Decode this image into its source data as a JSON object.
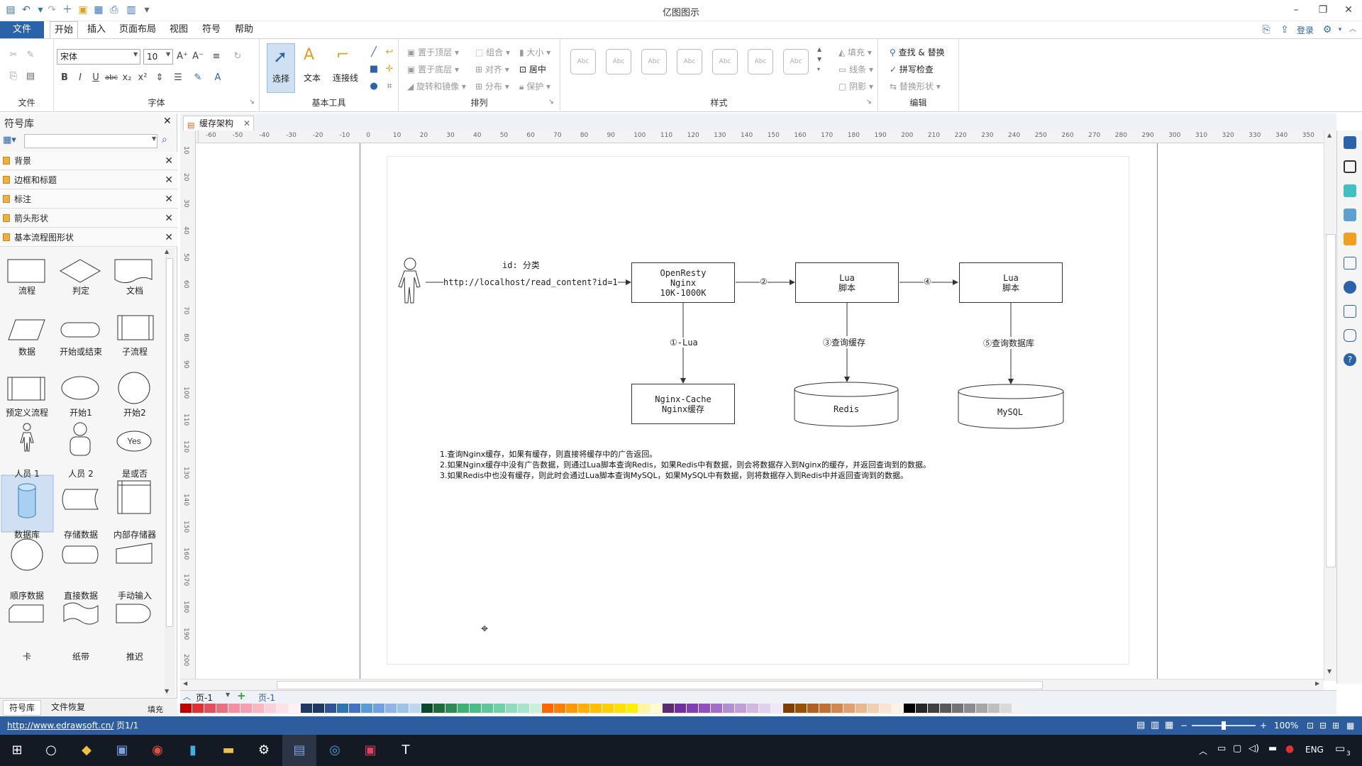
{
  "app": {
    "title": "亿图图示",
    "minimize": "–",
    "restore": "❐",
    "close": "✕"
  },
  "menu": {
    "file": "文件",
    "items": [
      "开始",
      "插入",
      "页面布局",
      "视图",
      "符号",
      "帮助"
    ],
    "login": "登录"
  },
  "ribbon": {
    "groups": {
      "file": "文件",
      "font": "字体",
      "basic_tools": "基本工具",
      "arrange": "排列",
      "style": "样式",
      "edit": "编辑"
    },
    "font_name": "宋体",
    "font_size": "10",
    "tools": {
      "select": "选择",
      "text": "文本",
      "connector": "连接线"
    },
    "arrange": {
      "bring_front": "置于顶层",
      "send_back": "置于底层",
      "rotate": "旋转和镜像",
      "group": "组合",
      "align": "对齐",
      "distribute": "分布",
      "size": "大小",
      "center": "居中",
      "protect": "保护"
    },
    "style_preview": "Abc",
    "fill": {
      "fill": "填充",
      "line": "线条",
      "shadow": "阴影"
    },
    "edit": {
      "find": "查找 & 替换",
      "spell": "拼写检查",
      "replace_shape": "替换形状"
    }
  },
  "library": {
    "title": "符号库",
    "categories": [
      "背景",
      "边框和标题",
      "标注",
      "箭头形状",
      "基本流程图形状"
    ],
    "shapes": [
      "流程",
      "判定",
      "文档",
      "数据",
      "开始或结束",
      "子流程",
      "预定义流程",
      "开始1",
      "开始2",
      "人员 1",
      "人员 2",
      "是或否",
      "数据库",
      "存储数据",
      "内部存储器",
      "顺序数据",
      "直接数据",
      "手动输入",
      "卡",
      "纸带",
      "推迟"
    ],
    "yes_text": "Yes",
    "bottom_tabs": [
      "符号库",
      "文件恢复"
    ]
  },
  "doc_tab": "缓存架构",
  "diagram": {
    "id_label": "id: 分类",
    "url": "http://localhost/read_content?id=1",
    "openresty": [
      "OpenResty",
      "Nginx",
      "10K-1000K"
    ],
    "lua1": [
      "Lua",
      "脚本"
    ],
    "lua2": [
      "Lua",
      "脚本"
    ],
    "step2": "②",
    "step4": "④",
    "step1": "①-Lua",
    "step3": "③查询缓存",
    "step5": "⑤查询数据库",
    "nginx_cache": [
      "Nginx-Cache",
      "Nginx缓存"
    ],
    "redis": "Redis",
    "mysql": "MySQL",
    "notes": [
      "1.查询Nginx缓存，如果有缓存，则直接将缓存中的广告返回。",
      "2.如果Nginx缓存中没有广告数据，则通过Lua脚本查询Redis，如果Redis中有数据，则会将数据存入到Nginx的缓存，并返回查询到的数据。",
      "3.如果Redis中也没有缓存，则此时会通过Lua脚本查询MySQL，如果MySQL中有数据，则将数据存入到Redis中并返回查询到的数据。"
    ]
  },
  "ruler_h": [
    "-60",
    "-50",
    "-40",
    "-30",
    "-20",
    "-10",
    "0",
    "10",
    "20",
    "30",
    "40",
    "50",
    "60",
    "70",
    "80",
    "90",
    "100",
    "110",
    "120",
    "130",
    "140",
    "150",
    "160",
    "170",
    "180",
    "190",
    "200",
    "210",
    "220",
    "230",
    "240",
    "250",
    "260",
    "270",
    "280",
    "290",
    "300",
    "310",
    "320",
    "330",
    "340",
    "350"
  ],
  "ruler_v": [
    "10",
    "20",
    "30",
    "40",
    "50",
    "60",
    "70",
    "80",
    "90",
    "100",
    "110",
    "120",
    "130",
    "140",
    "150",
    "160",
    "170",
    "180",
    "190",
    "200"
  ],
  "pages": {
    "tab1": "页-1",
    "tab2": "页-1",
    "fill_label": "填充"
  },
  "status": {
    "url": "http://www.edrawsoft.cn/",
    "page": "页1/1",
    "zoom": "100%"
  },
  "taskbar": {
    "lang": "ENG",
    "notif": "3"
  },
  "palette": [
    "#c00000",
    "#e03030",
    "#e05060",
    "#e87080",
    "#f090a0",
    "#f4a0b0",
    "#f8b8c0",
    "#fcd0d8",
    "#fde0e8",
    "#fff0f4",
    "#1f3864",
    "#203864",
    "#2f5597",
    "#2e75b6",
    "#4472c4",
    "#5b9bd5",
    "#70a0e0",
    "#8fb4e8",
    "#9dc3e6",
    "#bdd7ee",
    "#0a4a2a",
    "#1e6b3c",
    "#2e8b57",
    "#3cb371",
    "#4cbb88",
    "#5cc89a",
    "#70d0a8",
    "#90dcc0",
    "#a8e4cc",
    "#c8f0dc",
    "#ff6600",
    "#ff7f00",
    "#ff9900",
    "#ffb000",
    "#ffc000",
    "#ffd000",
    "#ffe000",
    "#fff000",
    "#fff5a0",
    "#fffad0",
    "#5b2c6f",
    "#7030a0",
    "#8040b0",
    "#9050c0",
    "#a070c8",
    "#b090d0",
    "#c0a0d8",
    "#d0b8e0",
    "#e0d0ec",
    "#f0e8f6",
    "#7f3f00",
    "#995000",
    "#b06020",
    "#c07030",
    "#d08850",
    "#e0a070",
    "#e8b890",
    "#f0d0b0",
    "#f8e4d0",
    "#fdf2e6",
    "#000000",
    "#262626",
    "#404040",
    "#595959",
    "#737373",
    "#8c8c8c",
    "#a6a6a6",
    "#bfbfbf",
    "#d9d9d9",
    "#f2f2f2"
  ]
}
